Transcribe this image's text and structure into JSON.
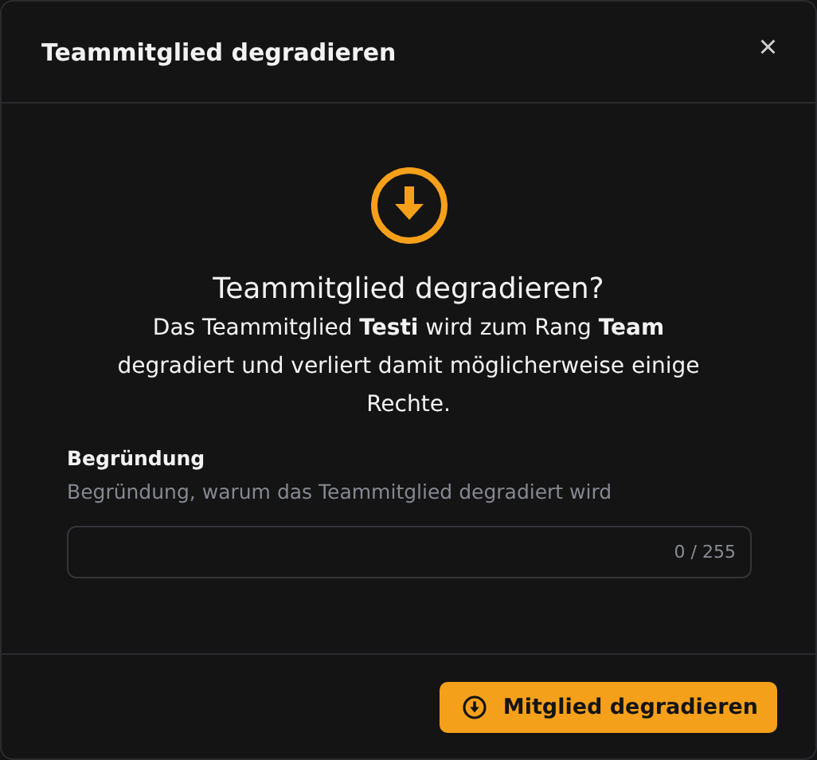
{
  "dialog": {
    "title": "Teammitglied degradieren",
    "close": "×"
  },
  "confirm": {
    "heading": "Teammitglied degradieren?",
    "message": "Das Teammitglied **Testi** wird zum Rang **Team** degradiert und verliert damit möglicherweise einige Rechte."
  },
  "reason": {
    "label": "Begründung",
    "description": "Begründung, warum das Teammitglied degradiert wird",
    "counter": "0 / 255"
  },
  "buttons": [
    {
      "label": "Mitglied degradieren",
      "kind": "primary"
    }
  ]
}
